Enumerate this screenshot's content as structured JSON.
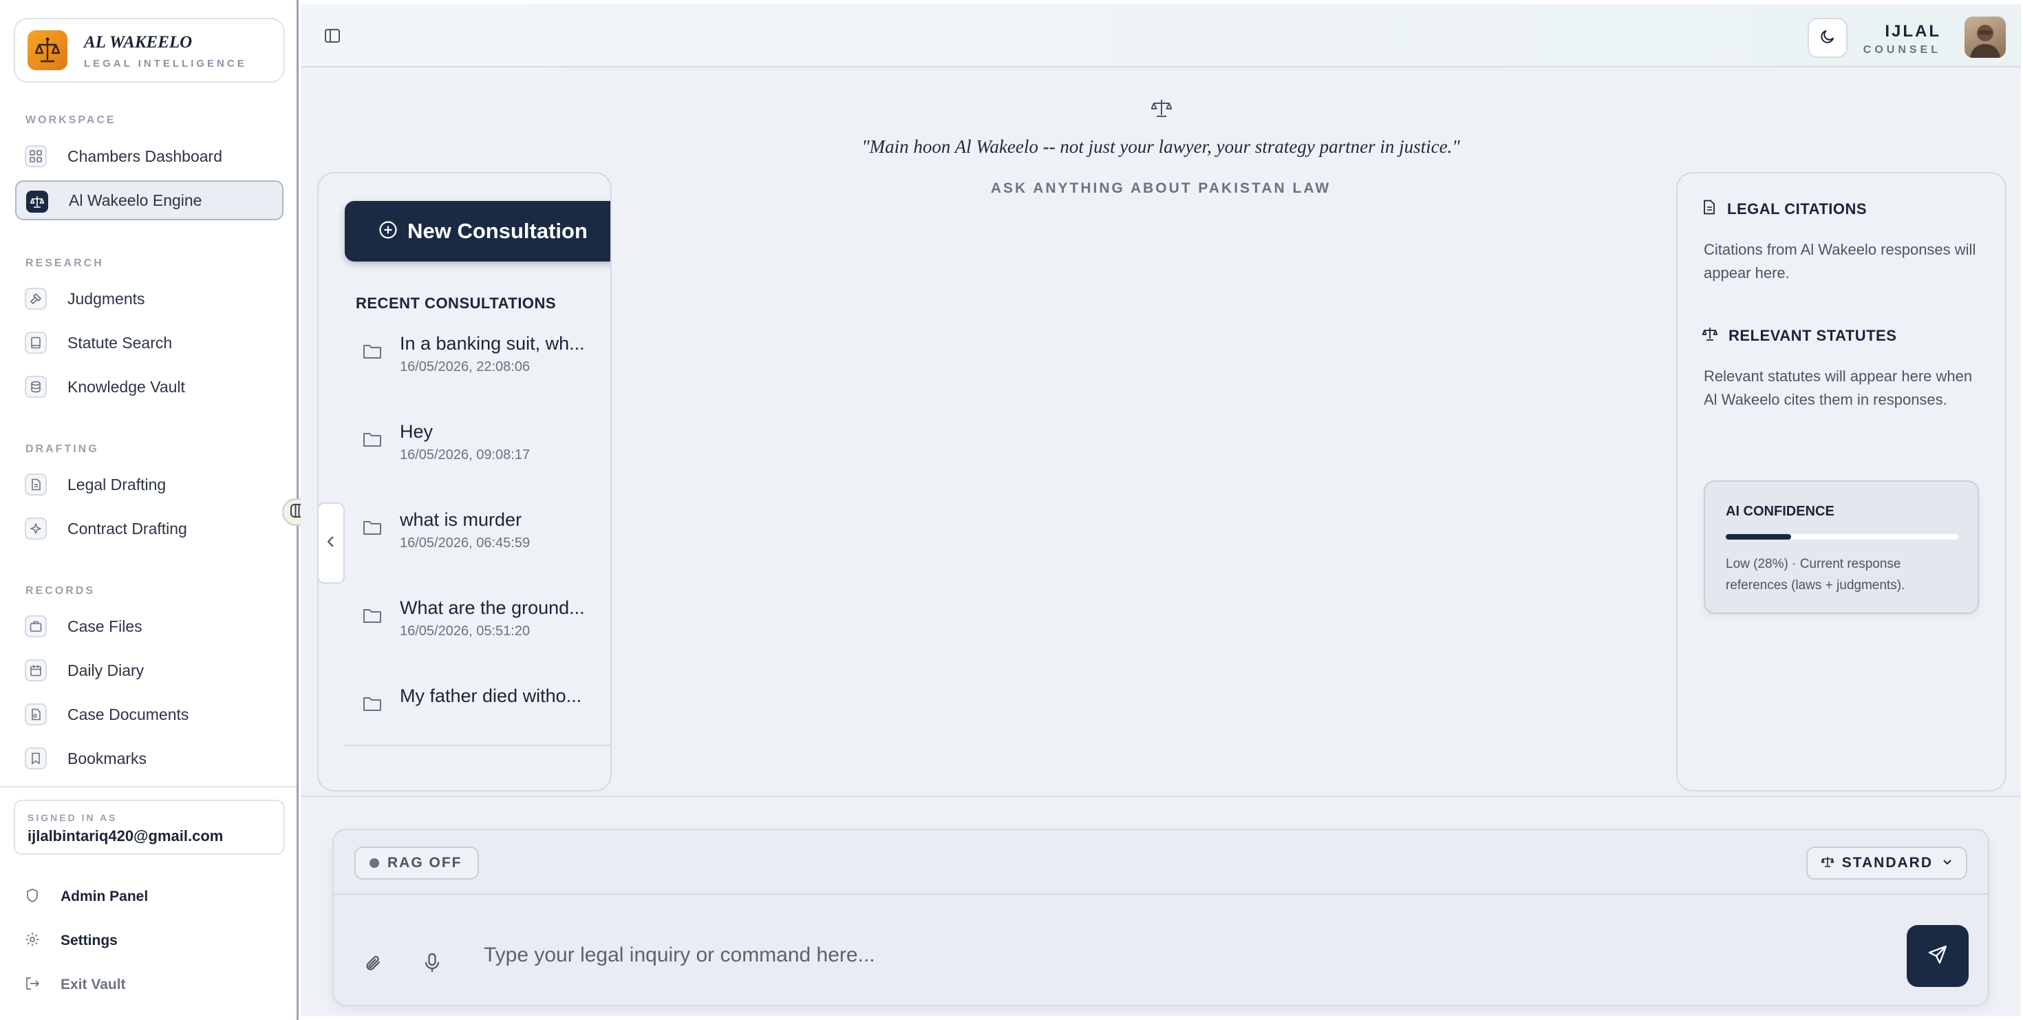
{
  "brand": {
    "title": "AL WAKEELO",
    "subtitle": "LEGAL INTELLIGENCE"
  },
  "sidebar": {
    "sections": [
      {
        "label": "WORKSPACE",
        "items": [
          {
            "label": "Chambers Dashboard",
            "icon": "dashboard-icon",
            "active": false
          },
          {
            "label": "Al Wakeelo Engine",
            "icon": "scale-icon",
            "active": true
          }
        ]
      },
      {
        "label": "RESEARCH",
        "items": [
          {
            "label": "Judgments",
            "icon": "gavel-icon"
          },
          {
            "label": "Statute Search",
            "icon": "book-icon"
          },
          {
            "label": "Knowledge Vault",
            "icon": "database-icon"
          }
        ]
      },
      {
        "label": "DRAFTING",
        "items": [
          {
            "label": "Legal Drafting",
            "icon": "document-icon"
          },
          {
            "label": "Contract Drafting",
            "icon": "sparkle-icon"
          }
        ]
      },
      {
        "label": "RECORDS",
        "items": [
          {
            "label": "Case Files",
            "icon": "briefcase-icon"
          },
          {
            "label": "Daily Diary",
            "icon": "calendar-icon"
          },
          {
            "label": "Case Documents",
            "icon": "file-icon"
          },
          {
            "label": "Bookmarks",
            "icon": "bookmark-icon"
          }
        ]
      }
    ],
    "signed_in": {
      "label": "SIGNED IN AS",
      "email": "ijlalbintariq420@gmail.com"
    },
    "footer": [
      {
        "label": "Admin Panel",
        "icon": "shield-icon"
      },
      {
        "label": "Settings",
        "icon": "gear-icon"
      },
      {
        "label": "Exit Vault",
        "icon": "logout-icon"
      }
    ]
  },
  "header": {
    "user_name": "IJLAL",
    "user_role": "COUNSEL"
  },
  "hero": {
    "quote": "\"Main hoon Al Wakeelo -- not just your lawyer, your strategy partner in justice.\"",
    "prompt": "ASK ANYTHING ABOUT PAKISTAN LAW"
  },
  "history": {
    "new_button": "New Consultation",
    "recent_label": "RECENT CONSULTATIONS",
    "items": [
      {
        "title": "In a banking suit, wh...",
        "date": "16/05/2026, 22:08:06"
      },
      {
        "title": "Hey",
        "date": "16/05/2026, 09:08:17"
      },
      {
        "title": "what is murder",
        "date": "16/05/2026, 06:45:59"
      },
      {
        "title": "What are the ground...",
        "date": "16/05/2026, 05:51:20"
      },
      {
        "title": "My father died witho...",
        "date": ""
      }
    ]
  },
  "right_panel": {
    "citations_title": "LEGAL CITATIONS",
    "citations_text": "Citations from Al Wakeelo responses will appear here.",
    "statutes_title": "RELEVANT STATUTES",
    "statutes_text": "Relevant statutes will appear here when Al Wakeelo cites them in responses.",
    "confidence_title": "AI CONFIDENCE",
    "confidence_value": 0.28,
    "confidence_text": "Low (28%) · Current response references (laws + judgments)."
  },
  "composer": {
    "rag_label": "RAG OFF",
    "mode_label": "STANDARD",
    "placeholder": "Type your legal inquiry or command here..."
  },
  "colors": {
    "primary": "#1b2a44",
    "brand_orange": "#f5a623",
    "background": "#eef1f6"
  }
}
